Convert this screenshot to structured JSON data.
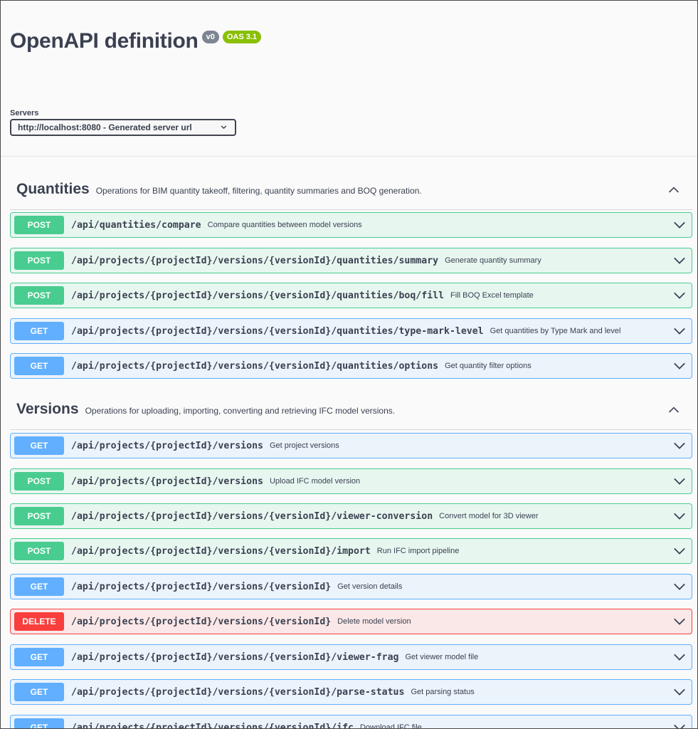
{
  "info": {
    "title": "OpenAPI definition",
    "version_badge": "v0",
    "oas_badge": "OAS 3.1",
    "servers_label": "Servers",
    "server_selected": "http://localhost:8080 - Generated server url"
  },
  "colors": {
    "post": "#49cc90",
    "get": "#61affe",
    "delete": "#f93e3e",
    "oas_badge": "#89bf04",
    "version_badge": "#7d8492"
  },
  "sections": [
    {
      "title": "Quantities",
      "description": "Operations for BIM quantity takeoff, filtering, quantity summaries and BOQ generation.",
      "operations": [
        {
          "method": "POST",
          "path": "/api/quantities/compare",
          "summary": "Compare quantities between model versions"
        },
        {
          "method": "POST",
          "path": "/api/projects/{projectId}/versions/{versionId}/quantities/summary",
          "summary": "Generate quantity summary"
        },
        {
          "method": "POST",
          "path": "/api/projects/{projectId}/versions/{versionId}/quantities/boq/fill",
          "summary": "Fill BOQ Excel template"
        },
        {
          "method": "GET",
          "path": "/api/projects/{projectId}/versions/{versionId}/quantities/type-mark-level",
          "summary": "Get quantities by Type Mark and level"
        },
        {
          "method": "GET",
          "path": "/api/projects/{projectId}/versions/{versionId}/quantities/options",
          "summary": "Get quantity filter options"
        }
      ]
    },
    {
      "title": "Versions",
      "description": "Operations for uploading, importing, converting and retrieving IFC model versions.",
      "operations": [
        {
          "method": "GET",
          "path": "/api/projects/{projectId}/versions",
          "summary": "Get project versions"
        },
        {
          "method": "POST",
          "path": "/api/projects/{projectId}/versions",
          "summary": "Upload IFC model version"
        },
        {
          "method": "POST",
          "path": "/api/projects/{projectId}/versions/{versionId}/viewer-conversion",
          "summary": "Convert model for 3D viewer"
        },
        {
          "method": "POST",
          "path": "/api/projects/{projectId}/versions/{versionId}/import",
          "summary": "Run IFC import pipeline"
        },
        {
          "method": "GET",
          "path": "/api/projects/{projectId}/versions/{versionId}",
          "summary": "Get version details"
        },
        {
          "method": "DELETE",
          "path": "/api/projects/{projectId}/versions/{versionId}",
          "summary": "Delete model version"
        },
        {
          "method": "GET",
          "path": "/api/projects/{projectId}/versions/{versionId}/viewer-frag",
          "summary": "Get viewer model file"
        },
        {
          "method": "GET",
          "path": "/api/projects/{projectId}/versions/{versionId}/parse-status",
          "summary": "Get parsing status"
        },
        {
          "method": "GET",
          "path": "/api/projects/{projectId}/versions/{versionId}/ifc",
          "summary": "Download IFC file"
        }
      ]
    }
  ]
}
